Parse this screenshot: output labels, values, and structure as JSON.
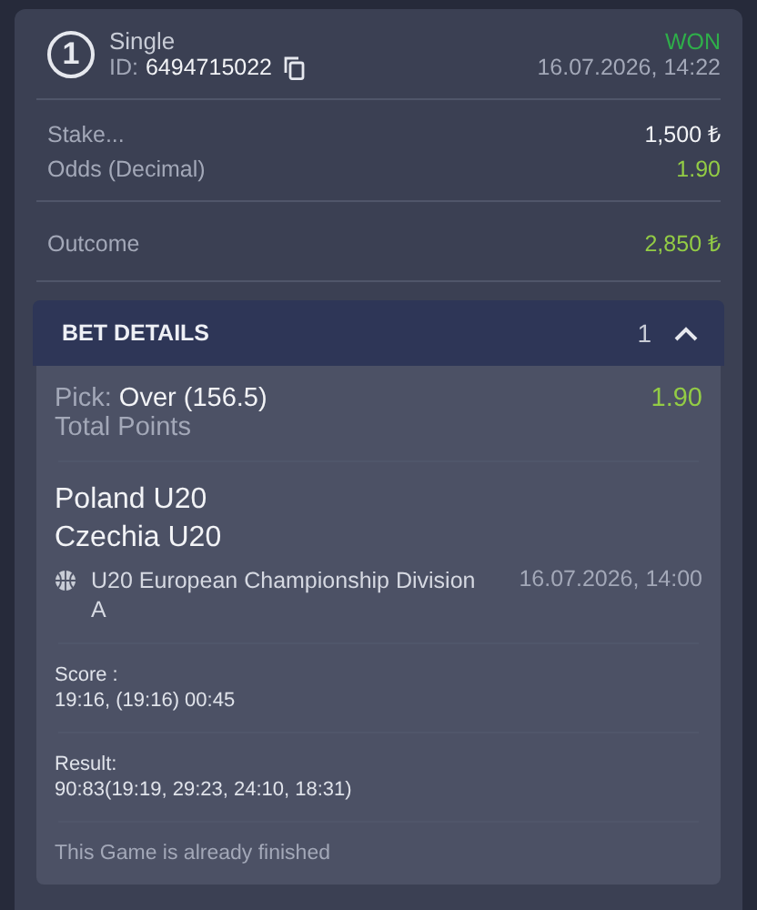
{
  "bet": {
    "number": "1",
    "type": "Single",
    "id_label": "ID:",
    "id": "6494715022",
    "status": "WON",
    "won": true,
    "date": "16.07.2026, 14:22"
  },
  "summary": [
    {
      "label": "Stake...",
      "value": "1,500 ₺",
      "kind": "plain"
    },
    {
      "label": "Odds (Decimal)",
      "value": "1.90",
      "kind": "odds"
    }
  ],
  "outcome": {
    "label": "Outcome",
    "value": "2,850 ₺"
  },
  "details": {
    "title": "BET DETAILS",
    "count": "1",
    "expanded": true,
    "pick_label": "Pick:",
    "pick_value": "Over (156.5)",
    "odds": "1.90",
    "market": "Total Points",
    "teams": [
      "Poland U20",
      "Czechia U20"
    ],
    "competition": "U20 European Championship Division A",
    "start": "16.07.2026, 14:00",
    "score_label": "Score :",
    "score": "19:16, (19:16) 00:45",
    "result_label": "Result:",
    "result": "90:83(19:19, 29:23, 24:10, 18:31)",
    "note": "This Game is already finished"
  }
}
